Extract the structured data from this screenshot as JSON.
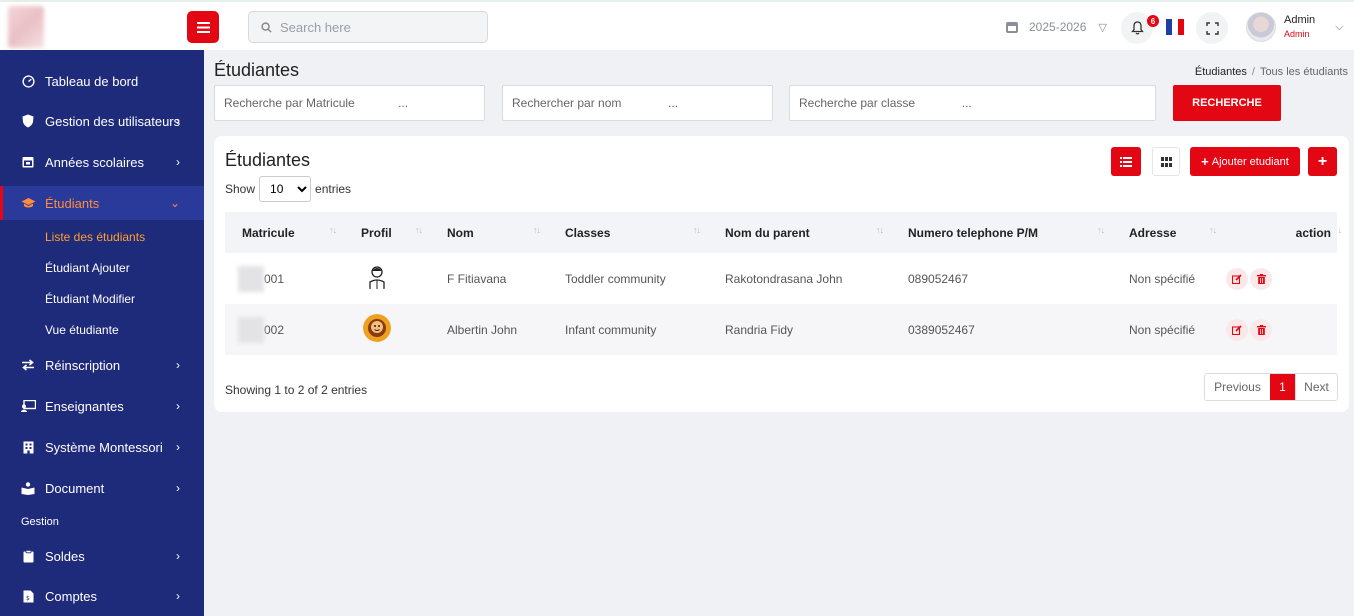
{
  "header": {
    "search_placeholder": "Search here",
    "school_year": "2025-2026",
    "notification_count": "6",
    "user_name": "Admin",
    "user_role": "Admin"
  },
  "colors": {
    "accent": "#e30613",
    "sidebar": "#1e2a7a",
    "active_text": "#ff9f2e"
  },
  "sidebar": {
    "items": [
      {
        "label": "Tableau de bord",
        "icon": "dashboard-icon"
      },
      {
        "label": "Gestion des utilisateurs",
        "icon": "shield-icon"
      },
      {
        "label": "Années scolaires",
        "icon": "calendar-icon"
      },
      {
        "label": "Étudiants",
        "icon": "graduation-cap-icon"
      },
      {
        "label": "Réinscription",
        "icon": "exchange-icon"
      },
      {
        "label": "Enseignantes",
        "icon": "teacher-board-icon"
      },
      {
        "label": "Système Montessori",
        "icon": "building-icon"
      },
      {
        "label": "Document",
        "icon": "reader-icon"
      },
      {
        "label": "Soldes",
        "icon": "clipboard-icon"
      },
      {
        "label": "Comptes",
        "icon": "invoice-icon"
      }
    ],
    "subitems": [
      "Liste des étudiants",
      "Étudiant Ajouter",
      "Étudiant Modifier",
      "Vue étudiante"
    ],
    "section": "Gestion"
  },
  "page": {
    "title": "Étudiantes",
    "breadcrumb": [
      "Étudiantes",
      "Tous les étudiants"
    ]
  },
  "filters": {
    "matricule_placeholder": "Recherche par Matricule             ...",
    "nom_placeholder": "Rechercher par nom              ...",
    "classe_placeholder": "Recherche par classe              ...",
    "button": "RECHERCHE"
  },
  "card": {
    "title": "Étudiantes",
    "show": "Show",
    "entries": "entries",
    "page_size": "10",
    "add_button": "Ajouter etudiant",
    "columns": [
      "Matricule",
      "Profil",
      "Nom",
      "Classes",
      "Nom du parent",
      "Numero telephone P/M",
      "Adresse",
      "action"
    ],
    "rows": [
      {
        "matricule": "001",
        "nom": "F Fitiavana",
        "classe": "Toddler community",
        "parent": "Rakotondrasana John",
        "phone": "089052467",
        "adresse": "Non spécifié"
      },
      {
        "matricule": "002",
        "nom": "Albertin John",
        "classe": "Infant community",
        "parent": "Randria Fidy",
        "phone": "0389052467",
        "adresse": "Non spécifié"
      }
    ],
    "info": "Showing 1 to 2 of 2 entries",
    "pager": {
      "prev": "Previous",
      "current": "1",
      "next": "Next"
    }
  }
}
